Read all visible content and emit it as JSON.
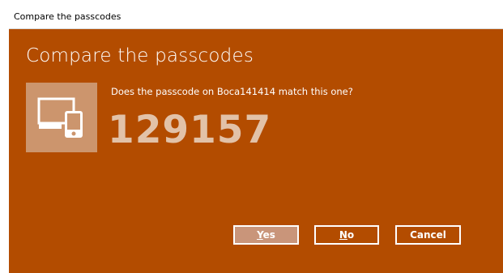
{
  "window": {
    "title": "Compare the passcodes"
  },
  "dialog": {
    "heading": "Compare the passcodes",
    "question": "Does the passcode on Boca141414 match this one?",
    "passcode": "129157",
    "icon": "devices-icon",
    "colors": {
      "background": "#b34c00",
      "tile": "#cc956d",
      "passcode_text": "#e2c2a8"
    }
  },
  "buttons": {
    "yes_access": "Y",
    "yes_rest": "es",
    "no_access": "N",
    "no_rest": "o",
    "cancel": "Cancel"
  }
}
